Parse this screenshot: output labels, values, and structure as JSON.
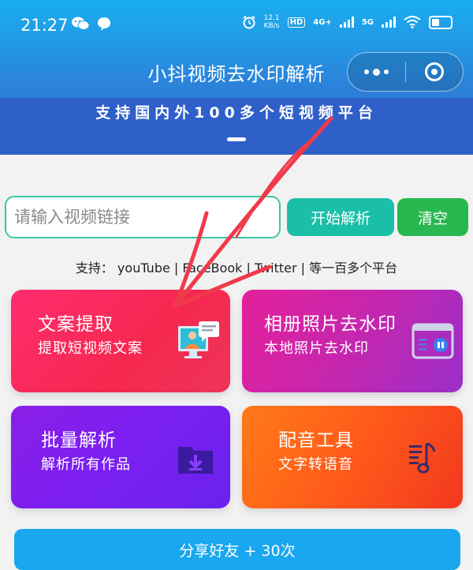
{
  "status_bar": {
    "time": "21:27",
    "net_speed_value": "12.1",
    "net_speed_unit": "KB/s",
    "sim_label": "HD",
    "network_4g": "4G+",
    "network_5g": "5G"
  },
  "nav": {
    "title": "小抖视频去水印解析"
  },
  "banner": {
    "text": "支持国内外100多个短视频平台"
  },
  "search": {
    "placeholder": "请输入视频链接",
    "value": ""
  },
  "buttons": {
    "parse": "开始解析",
    "clear": "清空",
    "share": "分享好友 + 30次"
  },
  "support": {
    "text": "支持：   youTube | FaceBook | Twitter | 等一百多个平台"
  },
  "cards": [
    {
      "title": "文案提取",
      "subtitle": "提取短视频文案",
      "icon": "computer-chat-icon"
    },
    {
      "title": "相册照片去水印",
      "subtitle": "本地照片去水印",
      "icon": "photo-album-icon"
    },
    {
      "title": "批量解析",
      "subtitle": "解析所有作品",
      "icon": "folder-download-icon"
    },
    {
      "title": "配音工具",
      "subtitle": "文字转语音",
      "icon": "music-note-icon"
    }
  ],
  "colors": {
    "header": "#19aef0",
    "parse_button": "#1bbfa8",
    "clear_button": "#29b74f",
    "share_button": "#19a7ef",
    "annotation_arrow": "#f03a4a"
  }
}
